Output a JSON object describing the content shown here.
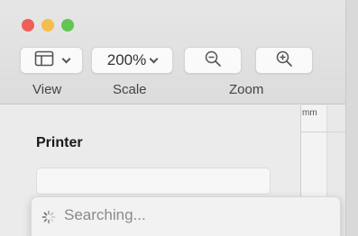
{
  "toolbar": {
    "view_label": "View",
    "scale_label": "Scale",
    "scale_value": "200%",
    "zoom_label": "Zoom"
  },
  "icons": {
    "view": "sidebar-layout-icon",
    "zoom_out": "magnifier-minus-icon",
    "zoom_in": "magnifier-plus-icon",
    "spinner": "loading-spinner-icon"
  },
  "ruler": {
    "unit": "mm"
  },
  "sidebar": {
    "printer_label": "Printer"
  },
  "printer_dropdown": {
    "status": "Searching..."
  },
  "colors": {
    "close": "#ee5f57",
    "minimize": "#f5bd4f",
    "maximize": "#62c554"
  }
}
